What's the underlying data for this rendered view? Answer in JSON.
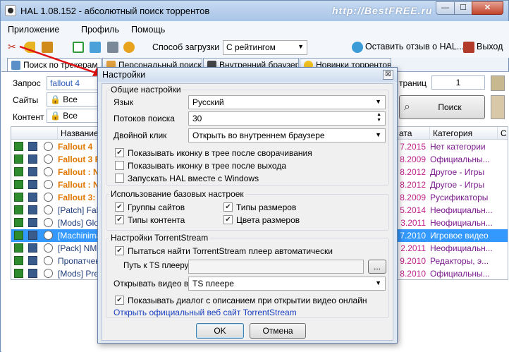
{
  "window": {
    "title": "HAL 1.08.152 - абсолютный поиск торрентов",
    "watermark": "http://BestFREE.ru",
    "controls": {
      "minimize": "—",
      "maximize": "☐",
      "close": "✕"
    }
  },
  "menu": {
    "items": [
      "Приложение",
      "Профиль",
      "Помощь"
    ]
  },
  "toolbar": {
    "download_mode_label": "Способ загрузки",
    "download_mode_value": "С рейтингом",
    "feedback_label": "Оставить отзыв о HAL...",
    "exit_label": "Выход"
  },
  "tabs": [
    {
      "label": "Поиск по трекерам",
      "icon": "search-icon"
    },
    {
      "label": "Персональный поиск",
      "icon": "person-icon"
    },
    {
      "label": "Внутренний браузер",
      "icon": "browser-icon"
    },
    {
      "label": "Новинки торрентов",
      "icon": "star-icon"
    }
  ],
  "search": {
    "query_label": "Запрос",
    "query_value": "fallout 4",
    "sites_label": "Сайты",
    "sites_value": "Все",
    "content_label": "Контент",
    "content_value": "Все",
    "pages_label": "траниц",
    "pages_value": "1",
    "search_button": "Поиск"
  },
  "grid": {
    "columns": [
      "Название",
      "ата",
      "Категория",
      "С"
    ],
    "rows": [
      {
        "name": "Fallout 4",
        "date": "7.2015",
        "category": "Нет категории",
        "name_color": "#e07800",
        "bold": true,
        "selected": false
      },
      {
        "name": "Fallout 3 F",
        "date": "8.2009",
        "category": "Официальны...",
        "name_color": "#e07800",
        "bold": true,
        "selected": false
      },
      {
        "name": "Fallout : N",
        "date": "8.2012",
        "category": "Другое - Игры",
        "name_color": "#e07800",
        "bold": true,
        "selected": false
      },
      {
        "name": "Fallout : N",
        "date": "8.2012",
        "category": "Другое - Игры",
        "name_color": "#e07800",
        "bold": true,
        "selected": false
      },
      {
        "name": "Fallout 3:",
        "date": "8.2009",
        "category": "Русификаторы",
        "name_color": "#e07800",
        "bold": true,
        "selected": false
      },
      {
        "name": "[Patch] Falle",
        "date": "5.2014",
        "category": "Неофициальн...",
        "name_color": "#1f3d7a",
        "bold": false,
        "selected": false
      },
      {
        "name": "[Mods] Glo",
        "date": "3.2011",
        "category": "Неофициальн...",
        "name_color": "#1f3d7a",
        "bold": false,
        "selected": false
      },
      {
        "name": "[Machinima",
        "date": "7.2010",
        "category": "Игровое видео",
        "name_color": "#ffffff",
        "bold": false,
        "selected": true
      },
      {
        "name": "[Pack] NMC",
        "date": "2.2011",
        "category": "Неофициальн...",
        "name_color": "#1f3d7a",
        "bold": false,
        "selected": false
      },
      {
        "name": "Пропатчен",
        "date": "9.2010",
        "category": "Редакторы, э...",
        "name_color": "#1f3d7a",
        "bold": false,
        "selected": false
      },
      {
        "name": "[Mods] Pre",
        "date": "8.2010",
        "category": "Официальны...",
        "name_color": "#1f3d7a",
        "bold": false,
        "selected": false
      }
    ]
  },
  "dialog": {
    "title": "Настройки",
    "close": "☒",
    "general": {
      "title": "Общие настройки",
      "language_label": "Язык",
      "language_value": "Русский",
      "threads_label": "Потоков поиска",
      "threads_value": "30",
      "dblclick_label": "Двойной клик",
      "dblclick_value": "Открыть во внутреннем браузере",
      "chk_tray_minimize": {
        "label": "Показывать иконку в трее после сворачивания",
        "checked": true
      },
      "chk_tray_exit": {
        "label": "Показывать иконку в трее после выхода",
        "checked": false
      },
      "chk_autostart": {
        "label": "Запускать HAL вместе с Windows",
        "checked": false
      }
    },
    "base": {
      "title": "Использование базовых настроек",
      "chk_site_groups": {
        "label": "Группы сайтов",
        "checked": true
      },
      "chk_content_types": {
        "label": "Типы контента",
        "checked": true
      },
      "chk_size_types": {
        "label": "Типы размеров",
        "checked": true
      },
      "chk_size_colors": {
        "label": "Цвета размеров",
        "checked": true
      }
    },
    "torrentstream": {
      "title": "Настройки TorrentStream",
      "chk_find_player": {
        "label": "Пытаться найти TorrentStream плеер автоматически",
        "checked": true
      },
      "path_label": "Путь к TS плееру",
      "path_value": "",
      "browse": "...",
      "open_label": "Открывать видео в",
      "open_value": "TS плеере",
      "chk_show_dialog": {
        "label": "Показывать диалог с описанием при открытии видео онлайн",
        "checked": true
      },
      "site_link": "Открыть официальный веб сайт TorrentStream"
    },
    "ok": "OK",
    "cancel": "Отмена"
  },
  "colors": {
    "accent": "#3399ff",
    "link": "#1a3fbf",
    "category": "#7a1a8c",
    "date": "#c0208a",
    "arrow": "#e01010"
  }
}
